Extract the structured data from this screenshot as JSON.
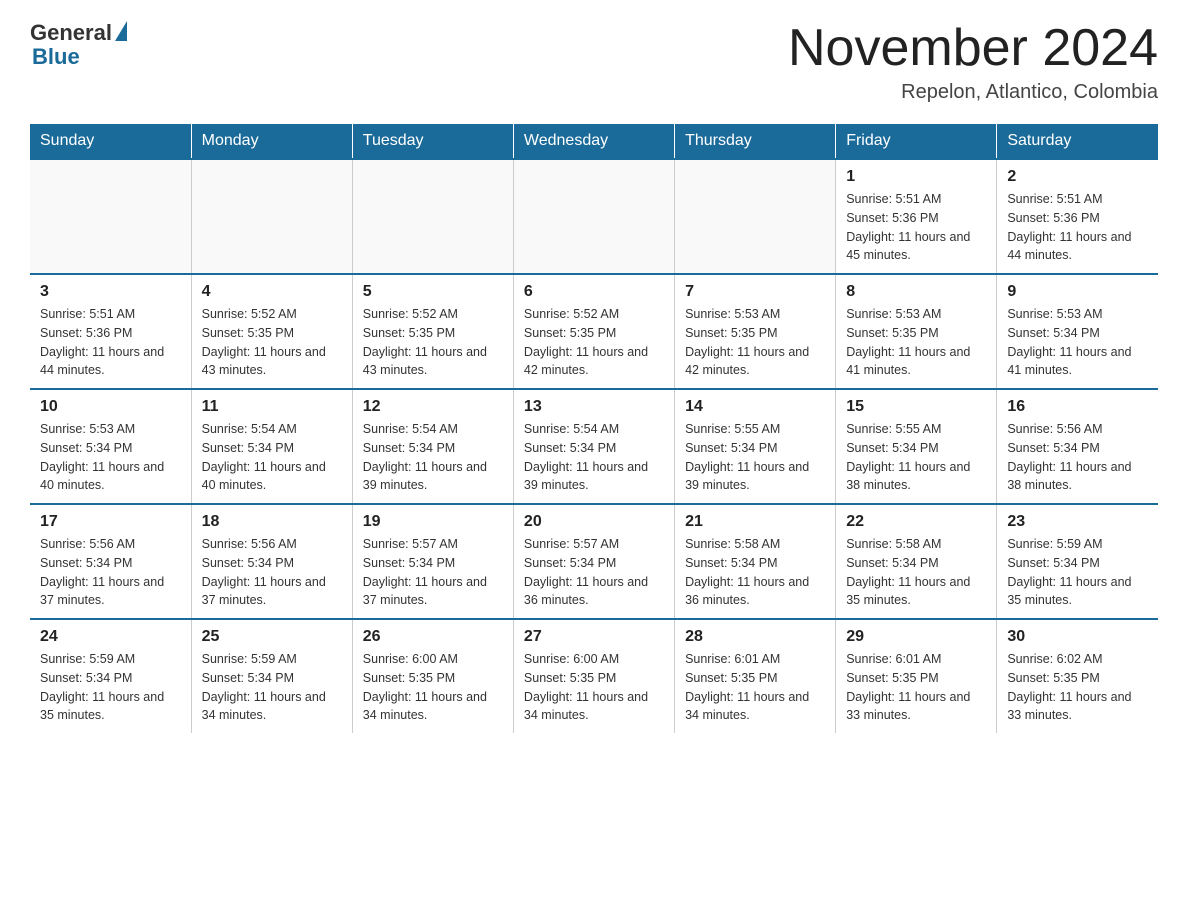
{
  "header": {
    "logo_general": "General",
    "logo_blue": "Blue",
    "title": "November 2024",
    "subtitle": "Repelon, Atlantico, Colombia"
  },
  "days_of_week": [
    "Sunday",
    "Monday",
    "Tuesday",
    "Wednesday",
    "Thursday",
    "Friday",
    "Saturday"
  ],
  "weeks": [
    [
      {
        "day": "",
        "info": ""
      },
      {
        "day": "",
        "info": ""
      },
      {
        "day": "",
        "info": ""
      },
      {
        "day": "",
        "info": ""
      },
      {
        "day": "",
        "info": ""
      },
      {
        "day": "1",
        "info": "Sunrise: 5:51 AM\nSunset: 5:36 PM\nDaylight: 11 hours and 45 minutes."
      },
      {
        "day": "2",
        "info": "Sunrise: 5:51 AM\nSunset: 5:36 PM\nDaylight: 11 hours and 44 minutes."
      }
    ],
    [
      {
        "day": "3",
        "info": "Sunrise: 5:51 AM\nSunset: 5:36 PM\nDaylight: 11 hours and 44 minutes."
      },
      {
        "day": "4",
        "info": "Sunrise: 5:52 AM\nSunset: 5:35 PM\nDaylight: 11 hours and 43 minutes."
      },
      {
        "day": "5",
        "info": "Sunrise: 5:52 AM\nSunset: 5:35 PM\nDaylight: 11 hours and 43 minutes."
      },
      {
        "day": "6",
        "info": "Sunrise: 5:52 AM\nSunset: 5:35 PM\nDaylight: 11 hours and 42 minutes."
      },
      {
        "day": "7",
        "info": "Sunrise: 5:53 AM\nSunset: 5:35 PM\nDaylight: 11 hours and 42 minutes."
      },
      {
        "day": "8",
        "info": "Sunrise: 5:53 AM\nSunset: 5:35 PM\nDaylight: 11 hours and 41 minutes."
      },
      {
        "day": "9",
        "info": "Sunrise: 5:53 AM\nSunset: 5:34 PM\nDaylight: 11 hours and 41 minutes."
      }
    ],
    [
      {
        "day": "10",
        "info": "Sunrise: 5:53 AM\nSunset: 5:34 PM\nDaylight: 11 hours and 40 minutes."
      },
      {
        "day": "11",
        "info": "Sunrise: 5:54 AM\nSunset: 5:34 PM\nDaylight: 11 hours and 40 minutes."
      },
      {
        "day": "12",
        "info": "Sunrise: 5:54 AM\nSunset: 5:34 PM\nDaylight: 11 hours and 39 minutes."
      },
      {
        "day": "13",
        "info": "Sunrise: 5:54 AM\nSunset: 5:34 PM\nDaylight: 11 hours and 39 minutes."
      },
      {
        "day": "14",
        "info": "Sunrise: 5:55 AM\nSunset: 5:34 PM\nDaylight: 11 hours and 39 minutes."
      },
      {
        "day": "15",
        "info": "Sunrise: 5:55 AM\nSunset: 5:34 PM\nDaylight: 11 hours and 38 minutes."
      },
      {
        "day": "16",
        "info": "Sunrise: 5:56 AM\nSunset: 5:34 PM\nDaylight: 11 hours and 38 minutes."
      }
    ],
    [
      {
        "day": "17",
        "info": "Sunrise: 5:56 AM\nSunset: 5:34 PM\nDaylight: 11 hours and 37 minutes."
      },
      {
        "day": "18",
        "info": "Sunrise: 5:56 AM\nSunset: 5:34 PM\nDaylight: 11 hours and 37 minutes."
      },
      {
        "day": "19",
        "info": "Sunrise: 5:57 AM\nSunset: 5:34 PM\nDaylight: 11 hours and 37 minutes."
      },
      {
        "day": "20",
        "info": "Sunrise: 5:57 AM\nSunset: 5:34 PM\nDaylight: 11 hours and 36 minutes."
      },
      {
        "day": "21",
        "info": "Sunrise: 5:58 AM\nSunset: 5:34 PM\nDaylight: 11 hours and 36 minutes."
      },
      {
        "day": "22",
        "info": "Sunrise: 5:58 AM\nSunset: 5:34 PM\nDaylight: 11 hours and 35 minutes."
      },
      {
        "day": "23",
        "info": "Sunrise: 5:59 AM\nSunset: 5:34 PM\nDaylight: 11 hours and 35 minutes."
      }
    ],
    [
      {
        "day": "24",
        "info": "Sunrise: 5:59 AM\nSunset: 5:34 PM\nDaylight: 11 hours and 35 minutes."
      },
      {
        "day": "25",
        "info": "Sunrise: 5:59 AM\nSunset: 5:34 PM\nDaylight: 11 hours and 34 minutes."
      },
      {
        "day": "26",
        "info": "Sunrise: 6:00 AM\nSunset: 5:35 PM\nDaylight: 11 hours and 34 minutes."
      },
      {
        "day": "27",
        "info": "Sunrise: 6:00 AM\nSunset: 5:35 PM\nDaylight: 11 hours and 34 minutes."
      },
      {
        "day": "28",
        "info": "Sunrise: 6:01 AM\nSunset: 5:35 PM\nDaylight: 11 hours and 34 minutes."
      },
      {
        "day": "29",
        "info": "Sunrise: 6:01 AM\nSunset: 5:35 PM\nDaylight: 11 hours and 33 minutes."
      },
      {
        "day": "30",
        "info": "Sunrise: 6:02 AM\nSunset: 5:35 PM\nDaylight: 11 hours and 33 minutes."
      }
    ]
  ]
}
